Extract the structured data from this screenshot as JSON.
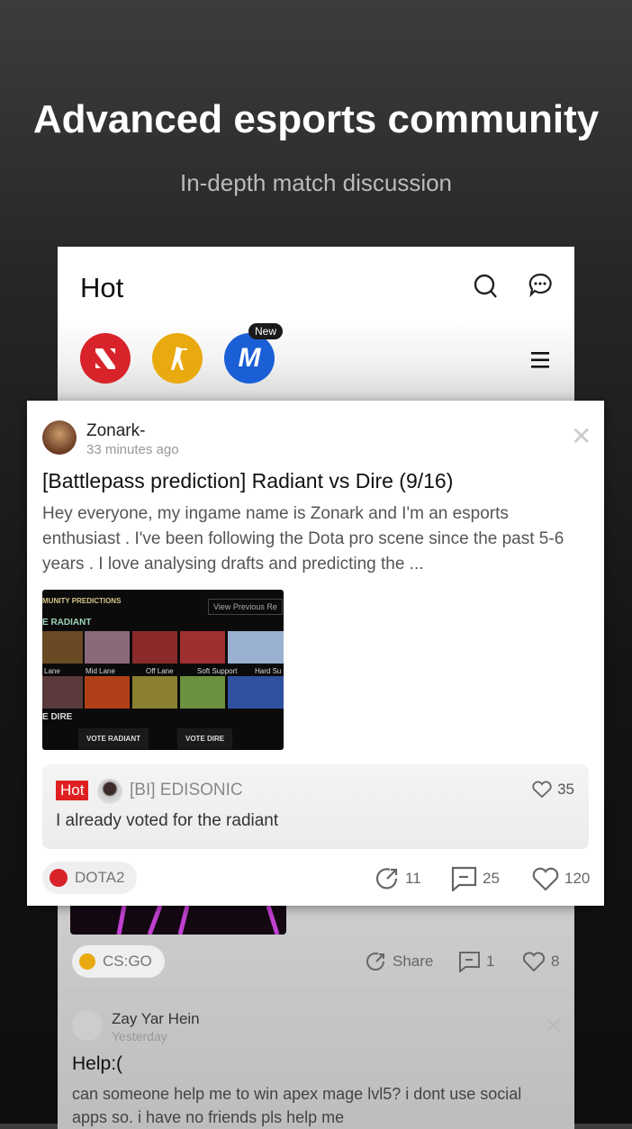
{
  "header": {
    "title": "Advanced esports community",
    "subtitle": "In-depth match discussion"
  },
  "app": {
    "page_title": "Hot",
    "new_badge": "New",
    "games": [
      {
        "name": "dota2",
        "color": "#d8232a"
      },
      {
        "name": "csgo",
        "color": "#e9aa10"
      },
      {
        "name": "m",
        "label": "M",
        "color": "#1b5fd6"
      }
    ]
  },
  "post": {
    "author": "Zonark-",
    "time": "33 minutes ago",
    "title": "[Battlepass prediction] Radiant vs Dire (9/16)",
    "body": "Hey everyone, my ingame name is Zonark and I'm an esports enthusiast . I've been following the Dota pro scene since the past 5-6 years . I love analysing drafts and predicting the ...",
    "image": {
      "header": "MUNITY PREDICTIONS",
      "view_prev": "View Previous Re",
      "radiant": "E RADIANT",
      "lanes": [
        "Lane",
        "Mid Lane",
        "Off Lane",
        "Soft Support",
        "Hard Su"
      ],
      "dire": "E DIRE",
      "vote_radiant": "VOTE RADIANT",
      "vote_dire": "VOTE DIRE"
    },
    "comment": {
      "badge": "Hot",
      "user": "[BI] EDISONIC",
      "likes": "35",
      "text": "I already voted for the radiant"
    },
    "tag": "DOTA2",
    "shares": "11",
    "comments": "25",
    "likes": "120"
  },
  "post2": {
    "tag": "CS:GO",
    "share": "Share",
    "comments": "1",
    "likes": "8"
  },
  "post3": {
    "author": "Zay Yar Hein",
    "time": "Yesterday",
    "title": "Help:(",
    "body": "can someone help me to win apex mage lvl5? i dont use social apps  so. i have no friends pls help me"
  }
}
